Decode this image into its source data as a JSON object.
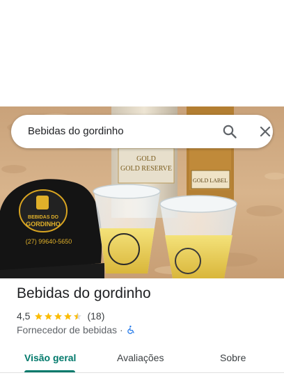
{
  "search": {
    "query": "Bebidas do gordinho"
  },
  "photo": {
    "cap_logo_line1": "BEBIDAS DO",
    "cap_logo_line2": "GORDINHO",
    "cap_phone": "(27) 99640-5650",
    "bottle_left_label": "GOLD RESERVE",
    "bottle_right_label": "GOLD LABEL"
  },
  "place": {
    "title": "Bebidas do gordinho",
    "rating": "4,5",
    "stars_filled": 4.5,
    "review_count": "(18)",
    "category": "Fornecedor de bebidas",
    "separator": "·"
  },
  "tabs": [
    {
      "label": "Visão geral",
      "active": true
    },
    {
      "label": "Avaliações",
      "active": false
    },
    {
      "label": "Sobre",
      "active": false
    }
  ],
  "colors": {
    "accent": "#00796b",
    "star": "#fbbc04",
    "accessibility": "#1a73e8"
  }
}
